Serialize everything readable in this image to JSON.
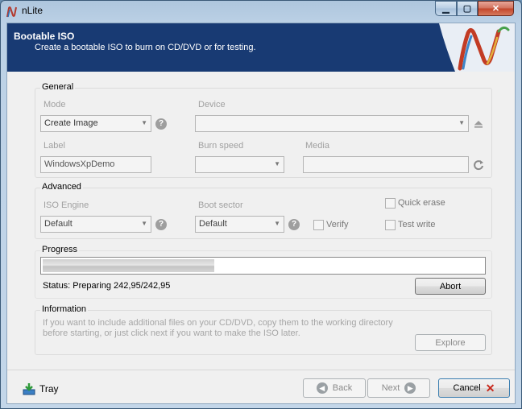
{
  "window": {
    "title": "nLite",
    "minimize": "▁",
    "maximize": "▢",
    "close": "✕"
  },
  "header": {
    "title": "Bootable ISO",
    "subtitle": "Create a bootable ISO to burn on CD/DVD or for testing."
  },
  "general": {
    "title": "General",
    "mode_label": "Mode",
    "mode_value": "Create Image",
    "device_label": "Device",
    "device_value": "",
    "label_label": "Label",
    "label_value": "WindowsXpDemo",
    "burn_speed_label": "Burn speed",
    "burn_speed_value": "",
    "media_label": "Media",
    "media_value": ""
  },
  "advanced": {
    "title": "Advanced",
    "iso_engine_label": "ISO Engine",
    "iso_engine_value": "Default",
    "boot_sector_label": "Boot sector",
    "boot_sector_value": "Default",
    "verify_label": "Verify",
    "quick_erase_label": "Quick erase",
    "test_write_label": "Test write"
  },
  "progress": {
    "title": "Progress",
    "percent": 39,
    "status": "Status: Preparing 242,95/242,95",
    "abort_label": "Abort"
  },
  "information": {
    "title": "Information",
    "text": "If you want to include additional files on your CD/DVD, copy them to the working directory before starting, or just click next if you want to make the ISO later.",
    "explore_label": "Explore"
  },
  "footer": {
    "tray_label": "Tray",
    "back_label": "Back",
    "next_label": "Next",
    "cancel_label": "Cancel"
  },
  "icons": {
    "help": "?",
    "arrow_down": "▼",
    "back": "◀",
    "next": "▶",
    "cancel": "✕"
  }
}
